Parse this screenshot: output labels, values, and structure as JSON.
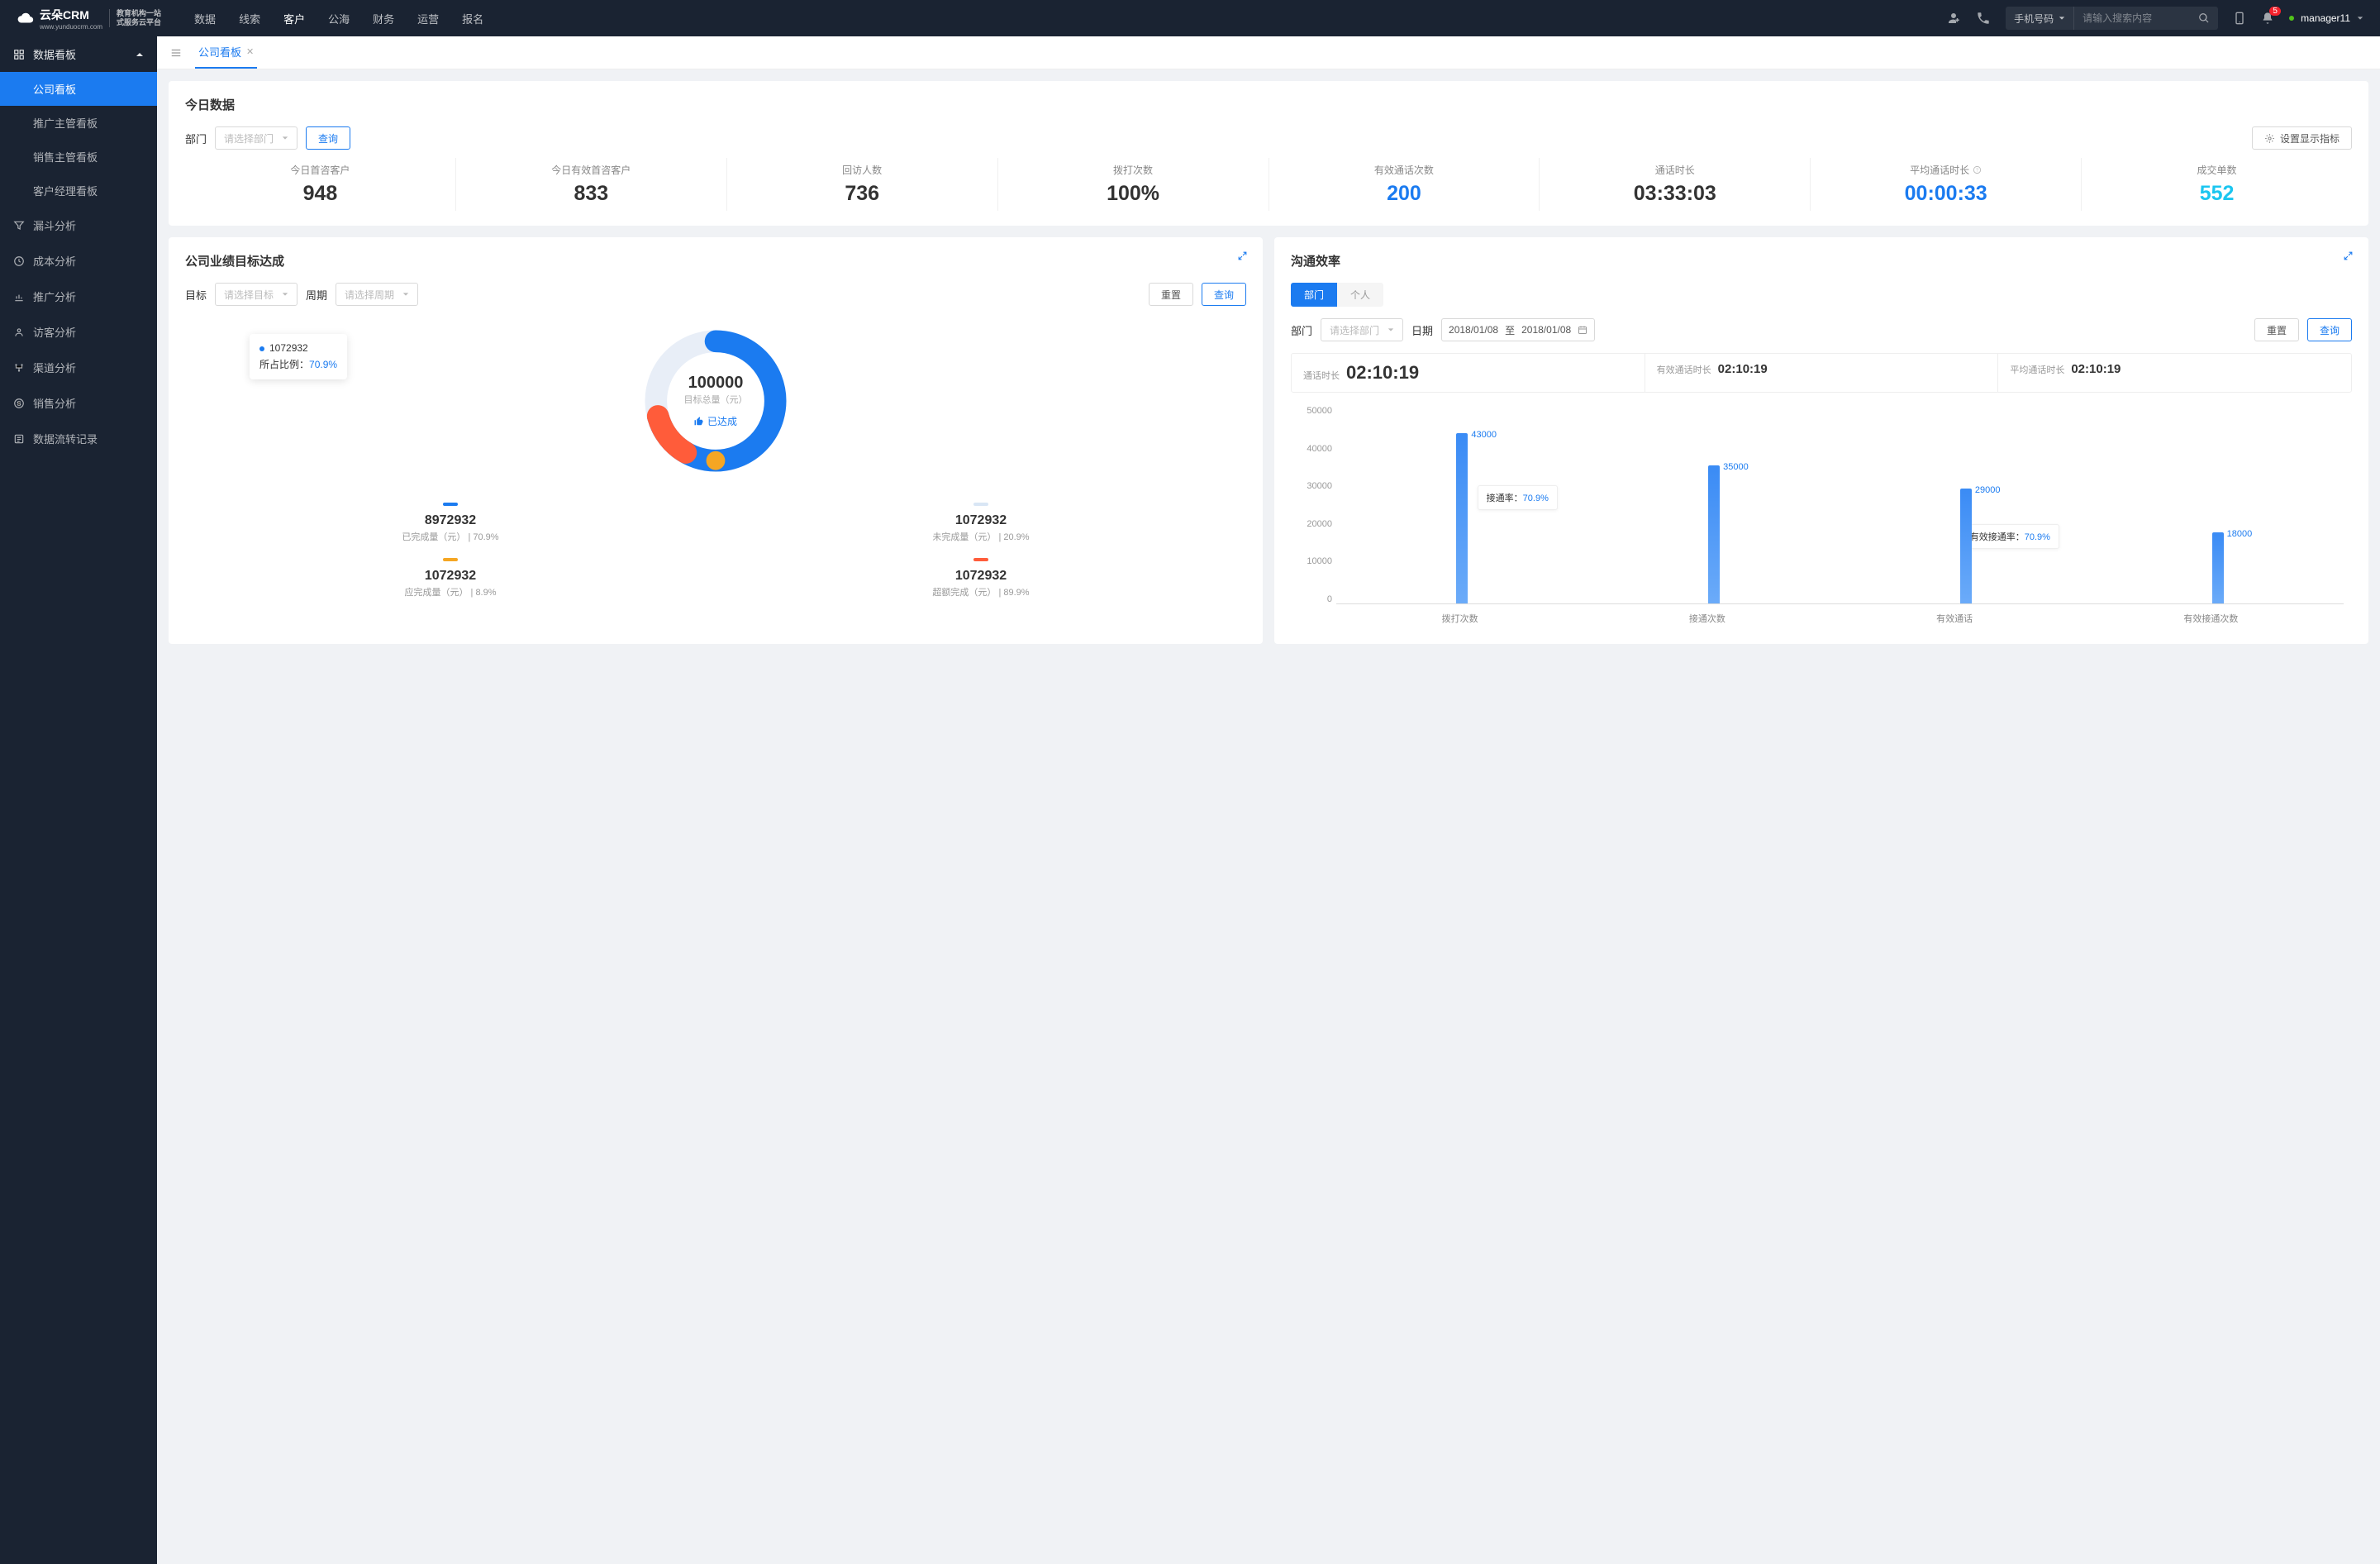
{
  "brand": {
    "name": "云朵CRM",
    "url": "www.yunduocrm.com",
    "tagline1": "教育机构一站",
    "tagline2": "式服务云平台"
  },
  "nav": [
    "数据",
    "线索",
    "客户",
    "公海",
    "财务",
    "运营",
    "报名"
  ],
  "nav_active_index": 2,
  "search": {
    "type": "手机号码",
    "placeholder": "请输入搜索内容"
  },
  "notify_count": "5",
  "user": "manager11",
  "sidebar": {
    "group": "数据看板",
    "children": [
      "公司看板",
      "推广主管看板",
      "销售主管看板",
      "客户经理看板"
    ],
    "active_index": 0,
    "items": [
      {
        "icon": "funnel",
        "label": "漏斗分析"
      },
      {
        "icon": "clock",
        "label": "成本分析"
      },
      {
        "icon": "chart",
        "label": "推广分析"
      },
      {
        "icon": "visitor",
        "label": "访客分析"
      },
      {
        "icon": "channel",
        "label": "渠道分析"
      },
      {
        "icon": "sales",
        "label": "销售分析"
      },
      {
        "icon": "flow",
        "label": "数据流转记录"
      }
    ]
  },
  "tab_label": "公司看板",
  "today": {
    "title": "今日数据",
    "dept_label": "部门",
    "dept_placeholder": "请选择部门",
    "query": "查询",
    "settings": "设置显示指标",
    "kpis": [
      {
        "label": "今日首咨客户",
        "value": "948",
        "color": "#333"
      },
      {
        "label": "今日有效首咨客户",
        "value": "833",
        "color": "#333"
      },
      {
        "label": "回访人数",
        "value": "736",
        "color": "#333"
      },
      {
        "label": "拨打次数",
        "value": "100%",
        "color": "#333"
      },
      {
        "label": "有效通话次数",
        "value": "200",
        "color": "#1b7bf0"
      },
      {
        "label": "通话时长",
        "value": "03:33:03",
        "color": "#333"
      },
      {
        "label": "平均通话时长",
        "value": "00:00:33",
        "color": "#1b7bf0",
        "help": true
      },
      {
        "label": "成交单数",
        "value": "552",
        "color": "#1bc6f0"
      }
    ]
  },
  "goal": {
    "title": "公司业绩目标达成",
    "target_label": "目标",
    "target_placeholder": "请选择目标",
    "period_label": "周期",
    "period_placeholder": "请选择周期",
    "reset": "重置",
    "query": "查询",
    "center_value": "100000",
    "center_label": "目标总量（元）",
    "status": "已达成",
    "tooltip_value": "1072932",
    "tooltip_ratio_label": "所占比例：",
    "tooltip_ratio": "70.9%",
    "legends": [
      {
        "color": "#1b7bf0",
        "value": "8972932",
        "label": "已完成量（元）",
        "pct": "70.9%"
      },
      {
        "color": "#d9e6f5",
        "value": "1072932",
        "label": "未完成量（元）",
        "pct": "20.9%"
      },
      {
        "color": "#f5a623",
        "value": "1072932",
        "label": "应完成量（元）",
        "pct": "8.9%"
      },
      {
        "color": "#ff5c3a",
        "value": "1072932",
        "label": "超额完成（元）",
        "pct": "89.9%"
      }
    ]
  },
  "comm": {
    "title": "沟通效率",
    "seg": [
      "部门",
      "个人"
    ],
    "dept_label": "部门",
    "dept_placeholder": "请选择部门",
    "date_label": "日期",
    "date_from": "2018/01/08",
    "date_sep": "至",
    "date_to": "2018/01/08",
    "reset": "重置",
    "query": "查询",
    "metrics": [
      {
        "label": "通话时长",
        "value": "02:10:19",
        "big": true
      },
      {
        "label": "有效通话时长",
        "value": "02:10:19"
      },
      {
        "label": "平均通话时长",
        "value": "02:10:19"
      }
    ],
    "rate1_label": "接通率：",
    "rate1": "70.9%",
    "rate2_label": "有效接通率：",
    "rate2": "70.9%"
  },
  "chart_data": [
    {
      "type": "pie",
      "title": "公司业绩目标达成",
      "series": [
        {
          "name": "已完成量",
          "value": 70.9,
          "color": "#1b7bf0"
        },
        {
          "name": "未完成量",
          "value": 20.9,
          "color": "#d9e6f5"
        },
        {
          "name": "超额/应完成",
          "value": 8.2,
          "color": "#ff5c3a"
        }
      ],
      "center_value": 100000,
      "center_label": "目标总量（元）"
    },
    {
      "type": "bar",
      "title": "沟通效率",
      "categories": [
        "拨打次数",
        "接通次数",
        "有效通话",
        "有效接通次数"
      ],
      "values": [
        43000,
        35000,
        29000,
        18000
      ],
      "ylim": [
        0,
        50000
      ],
      "y_ticks": [
        0,
        10000,
        20000,
        30000,
        40000,
        50000
      ],
      "annotations": [
        {
          "text": "接通率：70.9%"
        },
        {
          "text": "有效接通率：70.9%"
        }
      ]
    }
  ]
}
